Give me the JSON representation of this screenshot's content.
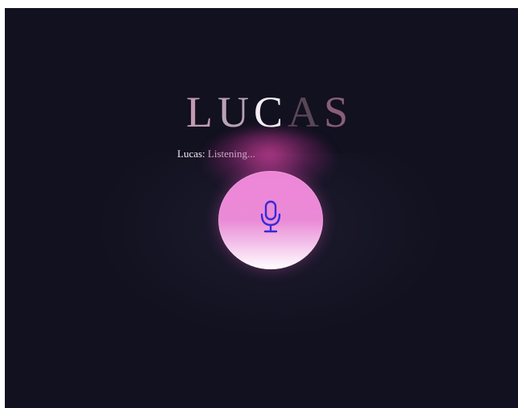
{
  "app": {
    "title_letters": [
      "L",
      "U",
      "C",
      "A",
      "S"
    ],
    "status_prefix": "Lucas: ",
    "status_text": "Listening..."
  },
  "mic_button": {
    "icon": "microphone-icon"
  },
  "colors": {
    "background": "#11111f",
    "accent_pink": "#ee86d8",
    "mic_icon": "#3a2ad6",
    "status_text": "#f3e9f1"
  }
}
